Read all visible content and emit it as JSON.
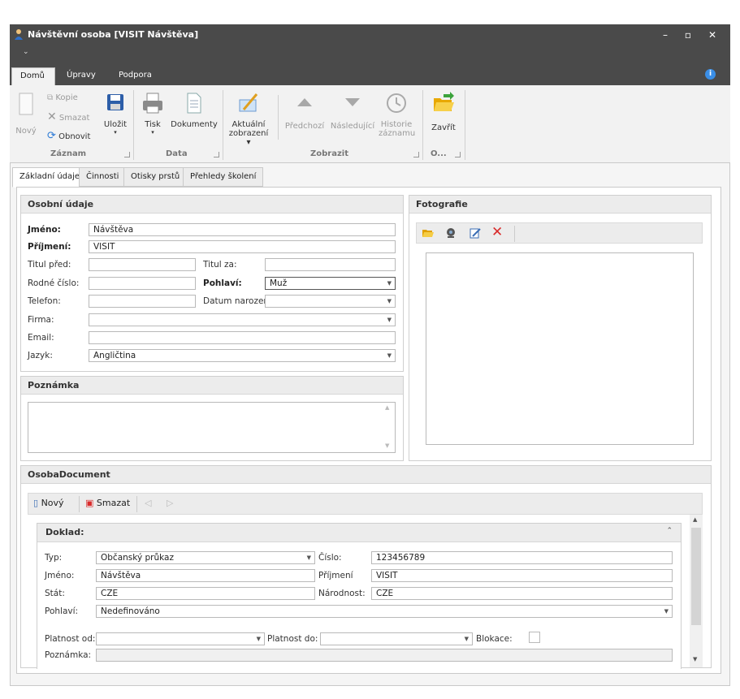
{
  "window": {
    "title": "Návštěvní osoba [VISIT Návštěva]",
    "qat_arrow": "⌄"
  },
  "ribbon_tabs": [
    "Domů",
    "Úpravy",
    "Podpora"
  ],
  "ribbon": {
    "zaznam": {
      "label": "Záznam",
      "novy": "Nový",
      "kopie": "Kopie",
      "smazat": "Smazat",
      "obnovit": "Obnovit",
      "ulozit": "Uložit"
    },
    "data": {
      "label": "Data",
      "tisk": "Tisk",
      "dokumenty": "Dokumenty"
    },
    "zobrazit": {
      "label": "Zobrazit",
      "aktualni1": "Aktuální",
      "aktualni2": "zobrazení ▾",
      "predchozi": "Předchozí",
      "nasledujici": "Následující",
      "historie1": "Historie",
      "historie2": "záznamu"
    },
    "o": {
      "label": "O...",
      "zavrit": "Zavřít"
    }
  },
  "content_tabs": [
    "Základní údaje",
    "Činnosti",
    "Otisky prstů",
    "Přehledy školení"
  ],
  "osobni": {
    "title": "Osobní údaje",
    "jmeno_label": "Jméno:",
    "jmeno": "Návštěva",
    "prijmeni_label": "Příjmení:",
    "prijmeni": "VISIT",
    "titul_pred_label": "Titul před:",
    "titul_pred": "",
    "titul_za_label": "Titul za:",
    "titul_za": "",
    "rodne_cislo_label": "Rodné číslo:",
    "rodne_cislo": "",
    "pohlavi_label": "Pohlaví:",
    "pohlavi": "Muž",
    "telefon_label": "Telefon:",
    "telefon": "",
    "datum_label": "Datum narození:",
    "datum": "",
    "firma_label": "Firma:",
    "firma": "",
    "email_label": "Email:",
    "email": "",
    "jazyk_label": "Jazyk:",
    "jazyk": "Angličtina"
  },
  "poznamka": {
    "title": "Poznámka"
  },
  "foto": {
    "title": "Fotografie"
  },
  "doc": {
    "title": "OsobaDocument",
    "novy": "Nový",
    "smazat": "Smazat",
    "doklad_title": "Doklad:",
    "typ_label": "Typ:",
    "typ": "Občanský průkaz",
    "cislo_label": "Číslo:",
    "cislo": "123456789",
    "jmeno_label": "Jméno:",
    "jmeno": "Návštěva",
    "prijmeni_label": "Příjmení",
    "prijmeni": "VISIT",
    "stat_label": "Stát:",
    "stat": "CZE",
    "narodnost_label": "Národnost:",
    "narodnost": "CZE",
    "pohlavi_label": "Pohlaví:",
    "pohlavi": "Nedefinováno",
    "platnost_od_label": "Platnost od:",
    "platnost_do_label": "Platnost do:",
    "blokace_label": "Blokace:",
    "poznamka_label": "Poznámka:"
  },
  "colors": {
    "titlebar": "#4a4a4a",
    "ribbon": "#f2f2f2",
    "close_red": "#d92b2b",
    "folder": "#f0b400"
  }
}
